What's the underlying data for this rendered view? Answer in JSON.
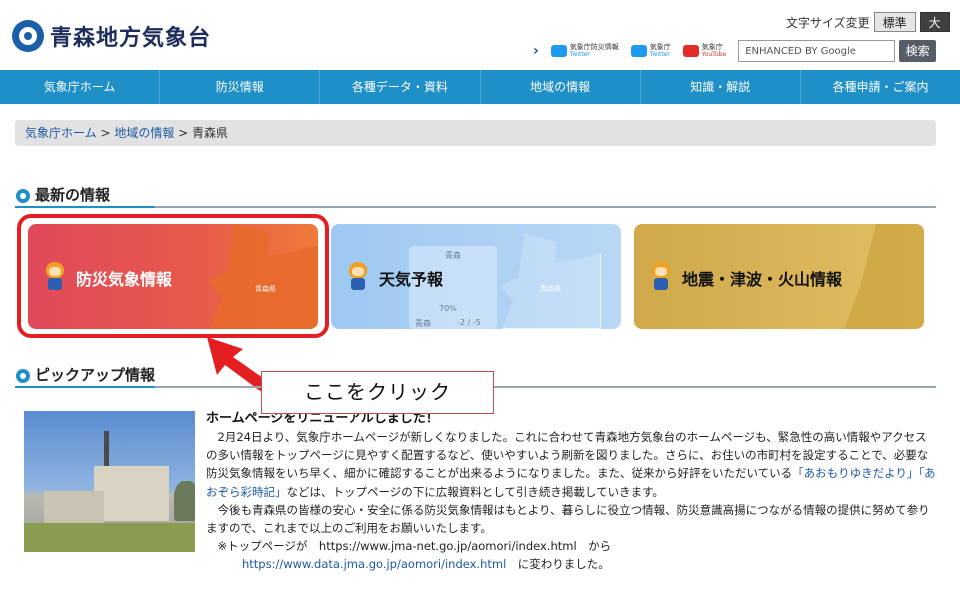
{
  "header": {
    "logo_text": "青森地方気象台",
    "fontsize_label": "文字サイズ変更",
    "fontsize_standard": "標準",
    "fontsize_large": "大",
    "sns": [
      {
        "label": "気象庁防災情報",
        "sub": "Twitter"
      },
      {
        "label": "気象庁",
        "sub": "Twitter"
      },
      {
        "label": "気象庁",
        "sub": "YouTube"
      }
    ],
    "search_placeholder": "ENHANCED BY Google",
    "search_button": "検索"
  },
  "nav": {
    "items": [
      "気象庁ホーム",
      "防災情報",
      "各種データ・資料",
      "地域の情報",
      "知識・解説",
      "各種申請・ご案内"
    ]
  },
  "breadcrumb": {
    "items": [
      "気象庁ホーム",
      "地域の情報",
      "青森県"
    ],
    "separator": " > "
  },
  "latest": {
    "title": "最新の情報",
    "cards": [
      {
        "label": "防災気象情報",
        "map_label": "青森県"
      },
      {
        "label": "天気予報",
        "map_label": "青森県",
        "panel_top": "青森",
        "panel_pct": "70%",
        "panel_city": "青森",
        "panel_temp": "-2 / -5"
      },
      {
        "label": "地震・津波・火山情報"
      }
    ]
  },
  "callout": {
    "text": "ここをクリック"
  },
  "pickup": {
    "title": "ピックアップ情報",
    "news_title": "ホームページをリニューアルしました！",
    "p1_a": "　2月24日より、気象庁ホームページが新しくなりました。これに合わせて青森地方気象台のホームページも、緊急性の高い情報やアクセスの多い情報をトップページに見やすく配置するなど、使いやすいよう刷新を図りました。さらに、お住いの市町村を設定することで、必要な防災気象情報をいち早く、細かに確認することが出来るようになりました。また、従来から好評をいただいている",
    "p1_link1": "「あおもりゆきだより」",
    "p1_link2": "「あおぞら彩時記」",
    "p1_b": "などは、トップページの下に広報資料として引き続き掲載していきます。",
    "p2": "　今後も青森県の皆様の安心・安全に係る防災気象情報はもとより、暮らしに役立つ情報、防災意識高揚につながる情報の提供に努めて参りますので、これまで以上のご利用をお願いいたします。",
    "p3_prefix": "　※トップページが　https://www.jma-net.go.jp/aomori/index.html　から",
    "p3_url": "https://www.data.jma.go.jp/aomori/index.html",
    "p3_suffix": "　に変わりました。"
  }
}
